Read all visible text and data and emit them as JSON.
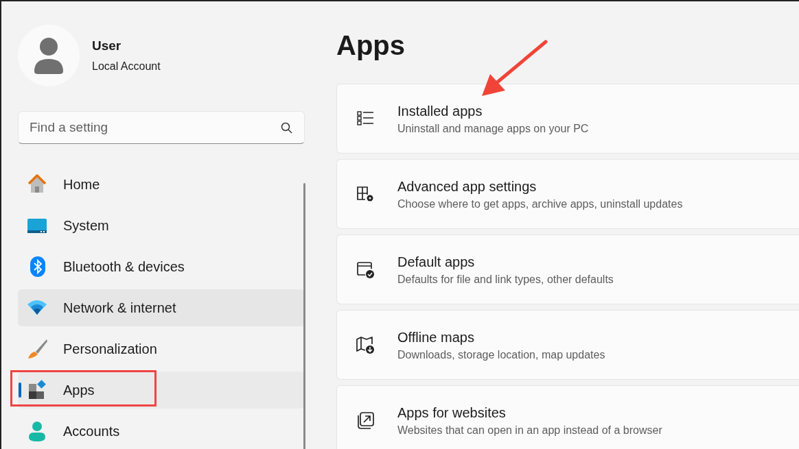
{
  "account": {
    "name": "User",
    "type": "Local Account"
  },
  "search": {
    "placeholder": "Find a setting"
  },
  "nav": [
    {
      "label": "Home",
      "selected": false,
      "hovered": false
    },
    {
      "label": "System",
      "selected": false,
      "hovered": false
    },
    {
      "label": "Bluetooth & devices",
      "selected": false,
      "hovered": false
    },
    {
      "label": "Network & internet",
      "selected": false,
      "hovered": true
    },
    {
      "label": "Personalization",
      "selected": false,
      "hovered": false
    },
    {
      "label": "Apps",
      "selected": true,
      "hovered": false
    },
    {
      "label": "Accounts",
      "selected": false,
      "hovered": false
    }
  ],
  "page_title": "Apps",
  "cards": [
    {
      "title": "Installed apps",
      "description": "Uninstall and manage apps on your PC"
    },
    {
      "title": "Advanced app settings",
      "description": "Choose where to get apps, archive apps, uninstall updates"
    },
    {
      "title": "Default apps",
      "description": "Defaults for file and link types, other defaults"
    },
    {
      "title": "Offline maps",
      "description": "Downloads, storage location, map updates"
    },
    {
      "title": "Apps for websites",
      "description": "Websites that can open in an app instead of a browser"
    }
  ]
}
